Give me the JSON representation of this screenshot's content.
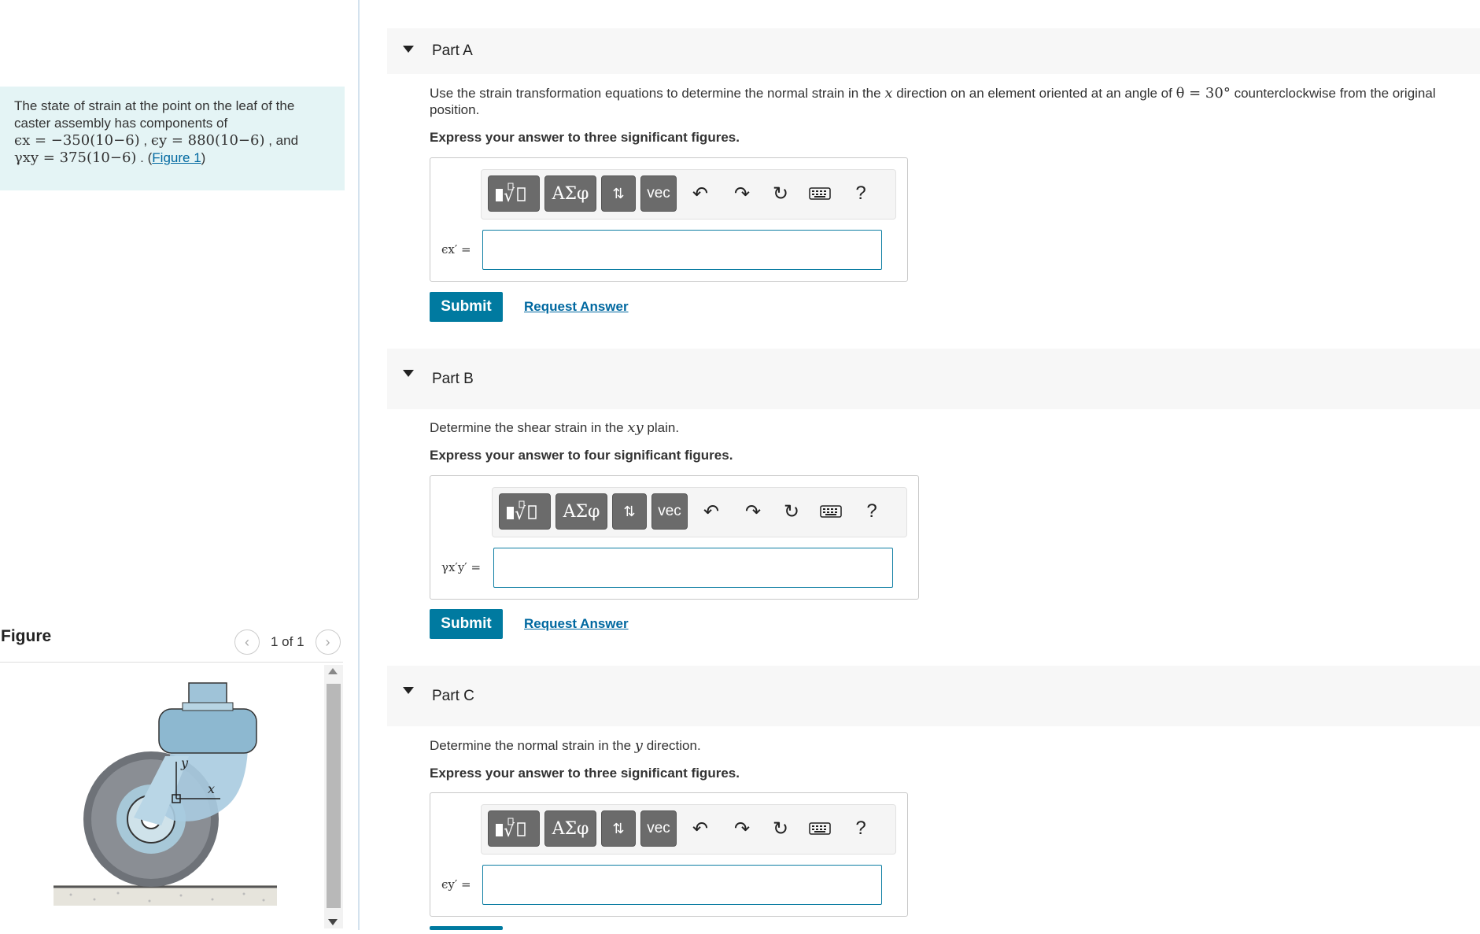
{
  "intro": {
    "text_before": "The state of strain at the point on the leaf of the caster assembly has components of",
    "strain_x": "ϵx = −350(10−6)",
    "strain_y": "ϵy = 880(10−6)",
    "strain_xy": "γxy = 375(10−6)",
    "and": "and",
    "figure_link": "Figure 1"
  },
  "figure": {
    "title": "Figure",
    "counter": "1 of 1",
    "prev_icon": "chevron-left-icon",
    "next_icon": "chevron-right-icon",
    "axis_y": "y",
    "axis_x": "x"
  },
  "toolbar": {
    "templates_icon": "fraction-root-template-icon",
    "greek_label": "ΑΣφ",
    "arrows_icon": "arrows-icon",
    "vec_label": "vec",
    "undo_icon": "undo-icon",
    "redo_icon": "redo-icon",
    "reset_icon": "reset-icon",
    "keyboard_icon": "keyboard-icon",
    "help_label": "?"
  },
  "parts": [
    {
      "title": "Part A",
      "question_pre": "Use the strain transformation equations to determine the normal strain in the ",
      "question_var": "x",
      "question_mid": " direction on an element oriented at an angle of ",
      "question_angle": "θ = 30°",
      "question_post": " counterclockwise from the original position.",
      "instruction": "Express your answer to three significant figures.",
      "field_label": "ϵx′ =",
      "answer_value": "",
      "submit": "Submit",
      "request": "Request Answer"
    },
    {
      "title": "Part B",
      "question_pre": "Determine the shear strain in the ",
      "question_var": "xy",
      "question_post": " plain.",
      "instruction": "Express your answer to four significant figures.",
      "field_label": "γx′y′ =",
      "answer_value": "",
      "submit": "Submit",
      "request": "Request Answer"
    },
    {
      "title": "Part C",
      "question_pre": "Determine the normal strain in the ",
      "question_var": "y",
      "question_post": " direction.",
      "instruction": "Express your answer to three significant figures.",
      "field_label": "ϵy′ =",
      "answer_value": ""
    }
  ]
}
